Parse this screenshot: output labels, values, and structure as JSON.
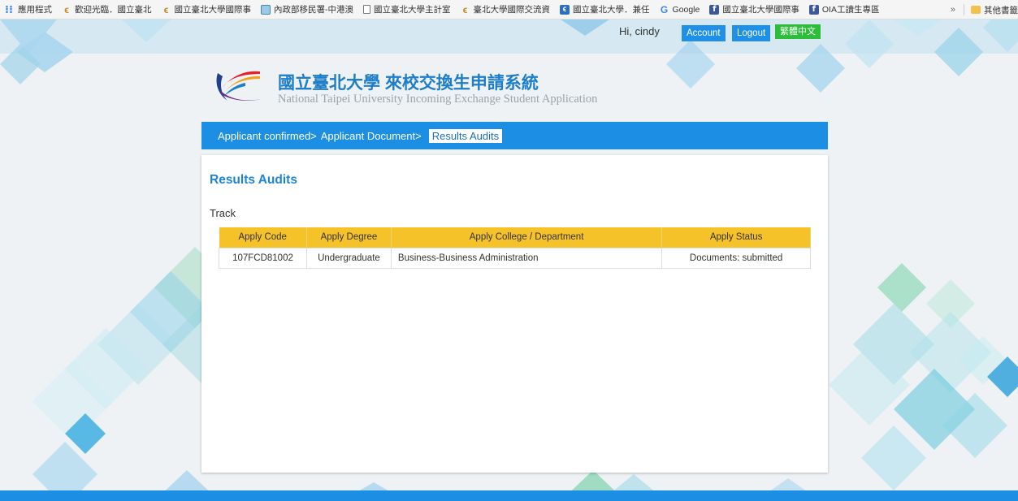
{
  "bookmarks": {
    "items": [
      {
        "label": "應用程式",
        "icon": "apps-grid-icon"
      },
      {
        "label": "歡迎光臨．國立臺北",
        "icon": "ntpu-logo-icon"
      },
      {
        "label": "國立臺北大學國際事",
        "icon": "ntpu-logo-icon"
      },
      {
        "label": "內政部移民署-中港澳",
        "icon": "image-icon"
      },
      {
        "label": "國立臺北大學主計室",
        "icon": "document-icon"
      },
      {
        "label": "臺北大學國際交流資",
        "icon": "ntpu-logo-icon"
      },
      {
        "label": "國立臺北大學．兼任",
        "icon": "ntpu-blue-icon"
      },
      {
        "label": "Google",
        "icon": "google-icon"
      },
      {
        "label": "國立臺北大學國際事",
        "icon": "facebook-icon"
      },
      {
        "label": "OIA工讀生專區",
        "icon": "facebook-icon"
      }
    ],
    "more": "»",
    "other_folder": "其他書籤"
  },
  "user_nav": {
    "greeting": "Hi, cindy",
    "account_label": "Account",
    "logout_label": "Logout",
    "language_label": "繁體中文"
  },
  "header": {
    "title_cn": "國立臺北大學 來校交換生申請系統",
    "title_en": "National Taipei University Incoming Exchange Student Application"
  },
  "breadcrumb": {
    "items": [
      "Applicant confirmed>",
      "Applicant Document>"
    ],
    "active": "Results Audits"
  },
  "main": {
    "title": "Results Audits",
    "track_label": "Track",
    "table": {
      "headers": [
        "Apply Code",
        "Apply Degree",
        "Apply College / Department",
        "Apply Status"
      ],
      "rows": [
        [
          "107FCD81002",
          "Undergraduate",
          "Business-Business Administration",
          "Documents: submitted"
        ]
      ]
    }
  },
  "colors": {
    "brand_blue": "#1c8fe5",
    "header_yellow": "#f6c22a",
    "lang_green": "#2dbd3a"
  }
}
